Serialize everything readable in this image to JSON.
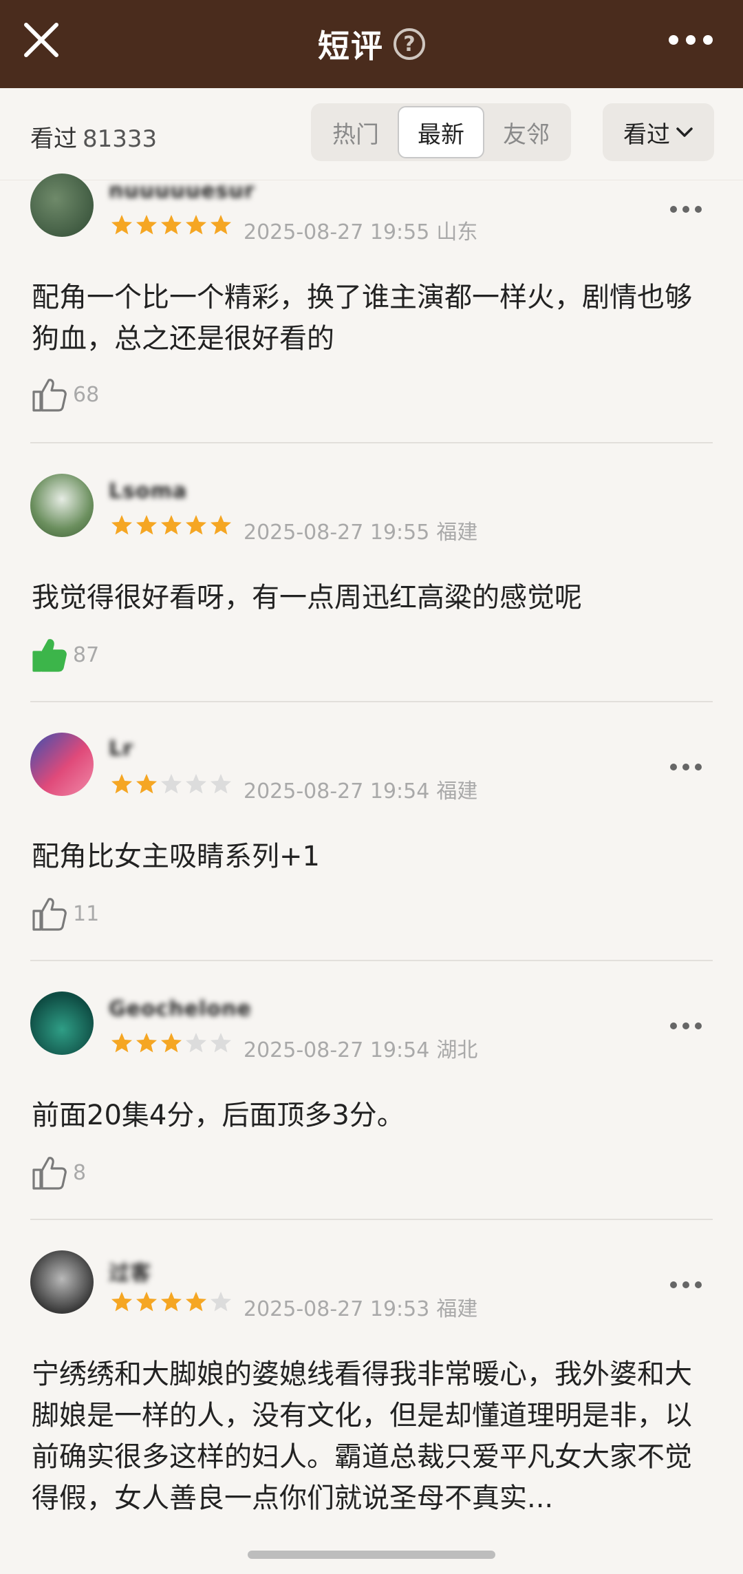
{
  "header": {
    "title": "短评",
    "help_symbol": "?"
  },
  "filter": {
    "seen_label": "看过",
    "seen_count": "81333",
    "tabs": [
      {
        "label": "热门",
        "active": false
      },
      {
        "label": "最新",
        "active": true
      },
      {
        "label": "友邻",
        "active": false
      }
    ],
    "dropdown_label": "看过"
  },
  "colors": {
    "header_bg": "#4a2c1d",
    "star_on": "#f5a623",
    "star_off": "#dcdcdc",
    "like_active": "#3cb54a"
  },
  "reviews": [
    {
      "username": "nuuuuuesur",
      "rating": 5,
      "time": "2025-08-27 19:55",
      "location": "山东",
      "content": "配角一个比一个精彩，换了谁主演都一样火，剧情也够狗血，总之还是很好看的",
      "likes": "68",
      "liked": false
    },
    {
      "username": "Lsoma",
      "rating": 5,
      "time": "2025-08-27 19:55",
      "location": "福建",
      "content": "我觉得很好看呀，有一点周迅红高粱的感觉呢",
      "likes": "87",
      "liked": true
    },
    {
      "username": "Lr",
      "rating": 2,
      "time": "2025-08-27 19:54",
      "location": "福建",
      "content": "配角比女主吸睛系列+1",
      "likes": "11",
      "liked": false
    },
    {
      "username": "Geochelone",
      "rating": 3,
      "time": "2025-08-27 19:54",
      "location": "湖北",
      "content": "前面20集4分，后面顶多3分。",
      "likes": "8",
      "liked": false
    },
    {
      "username": "过客",
      "rating": 4,
      "time": "2025-08-27 19:53",
      "location": "福建",
      "content": "宁绣绣和大脚娘的婆媳线看得我非常暖心，我外婆和大脚娘是一样的人，没有文化，但是却懂道理明是非，以前确实很多这样的妇人。霸道总裁只爱平凡女大家不觉得假，女人善良一点你们就说圣母不真实...",
      "likes": "",
      "liked": false
    }
  ]
}
